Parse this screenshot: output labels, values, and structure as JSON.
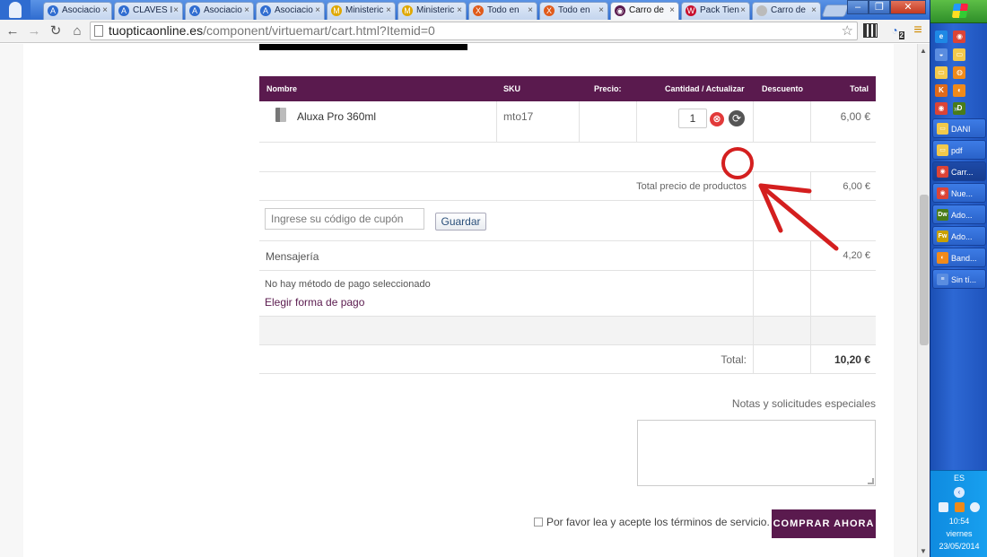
{
  "browser": {
    "tabs": [
      {
        "label": "Asociacio",
        "icon_color": "#2f6cd0",
        "icon": "A",
        "active": false
      },
      {
        "label": "CLAVES I",
        "icon_color": "#2f6cd0",
        "icon": "A",
        "active": false
      },
      {
        "label": "Asociacio",
        "icon_color": "#2f6cd0",
        "icon": "A",
        "active": false
      },
      {
        "label": "Asociacio",
        "icon_color": "#2f6cd0",
        "icon": "A",
        "active": false
      },
      {
        "label": "Ministeric",
        "icon_color": "#e0a800",
        "icon": "M",
        "active": false
      },
      {
        "label": "Ministeric",
        "icon_color": "#e0a800",
        "icon": "M",
        "active": false
      },
      {
        "label": "Todo en",
        "icon_color": "#e05a1a",
        "icon": "X",
        "active": false
      },
      {
        "label": "Todo en",
        "icon_color": "#e05a1a",
        "icon": "X",
        "active": false
      },
      {
        "label": "Carro de",
        "icon_color": "#5a1a4e",
        "icon": "◉",
        "active": true
      },
      {
        "label": "Pack Tien",
        "icon_color": "#c8102e",
        "icon": "W",
        "active": false
      },
      {
        "label": "Carro de",
        "icon_color": "#bbbbbb",
        "icon": "",
        "active": false
      }
    ],
    "url_host": "tuopticaonline.es",
    "url_path": "/component/virtuemart/cart.html?Itemid=0",
    "extension_badge": "2"
  },
  "cart": {
    "headers": {
      "name": "Nombre",
      "sku": "SKU",
      "price": "Precio:",
      "qty": "Cantidad / Actualizar",
      "discount": "Descuento",
      "total": "Total"
    },
    "product": {
      "name": "Aluxa Pro 360ml",
      "sku": "mto17",
      "price": "",
      "qty": "1",
      "total": "6,00 €"
    },
    "subtotal_label": "Total precio de productos",
    "subtotal_value": "6,00 €",
    "coupon_placeholder": "Ingrese su código de cupón",
    "coupon_button": "Guardar",
    "shipping_label": "Mensajería",
    "shipping_value": "4,20 €",
    "payment_none": "No hay método de pago seleccionado",
    "payment_choose": "Elegir forma de pago",
    "total_label": "Total:",
    "total_value": "10,20 €"
  },
  "notes_label": "Notas y solicitudes especiales",
  "tos_label": "Por favor lea y acepte los términos de servicio.",
  "buy_button": "COMPRAR AHORA",
  "colors": {
    "brand": "#5a1a4e",
    "annotation": "#d41f1f",
    "remove": "#e23a3a"
  },
  "taskbar": {
    "tasks": [
      {
        "label": "DANI",
        "icon": "▭",
        "icon_color": "#f2c94c"
      },
      {
        "label": "pdf",
        "icon": "▭",
        "icon_color": "#f2c94c"
      },
      {
        "label": "Carr...",
        "icon": "◉",
        "icon_color": "#db4437",
        "active": true
      },
      {
        "label": "Nue...",
        "icon": "◉",
        "icon_color": "#db4437"
      },
      {
        "label": "Ado...",
        "icon": "Dw",
        "icon_color": "#4a7c1a"
      },
      {
        "label": "Ado...",
        "icon": "Fw",
        "icon_color": "#c8a000"
      },
      {
        "label": "Band...",
        "icon": "◐",
        "icon_color": "#f08a1a"
      },
      {
        "label": "Sin tí...",
        "icon": "≡",
        "icon_color": "#5a8de0"
      }
    ],
    "language": "ES",
    "time": "10:54",
    "day": "viernes",
    "date": "23/05/2014"
  }
}
